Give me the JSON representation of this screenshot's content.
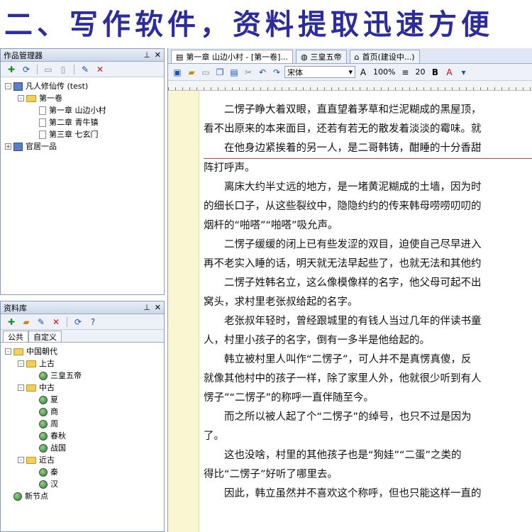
{
  "banner": {
    "text": "二、写作软件，资料提取迅速方便"
  },
  "works_panel": {
    "title": "作品管理器",
    "tree": [
      {
        "label": "凡人修仙传 (test)",
        "level": 0,
        "toggle": "-",
        "icon": "book"
      },
      {
        "label": "第一卷",
        "level": 1,
        "toggle": "-",
        "icon": "folder"
      },
      {
        "label": "第一章 山边小村",
        "level": 2,
        "icon": "doc"
      },
      {
        "label": "第二章 青牛镇",
        "level": 2,
        "icon": "doc"
      },
      {
        "label": "第三章 七玄门",
        "level": 2,
        "icon": "doc"
      },
      {
        "label": "官居一品",
        "level": 0,
        "toggle": "+",
        "icon": "book"
      }
    ]
  },
  "library_panel": {
    "title": "资料库",
    "tabs": [
      "公共",
      "自定义"
    ],
    "tree": [
      {
        "label": "中国朝代",
        "level": 0,
        "toggle": "-",
        "icon": "folder"
      },
      {
        "label": "上古",
        "level": 1,
        "toggle": "-",
        "icon": "folder"
      },
      {
        "label": "三皇五帝",
        "level": 2,
        "icon": "globe"
      },
      {
        "label": "中古",
        "level": 1,
        "toggle": "-",
        "icon": "folder"
      },
      {
        "label": "夏",
        "level": 2,
        "icon": "globe"
      },
      {
        "label": "商",
        "level": 2,
        "icon": "globe"
      },
      {
        "label": "周",
        "level": 2,
        "icon": "globe"
      },
      {
        "label": "春秋",
        "level": 2,
        "icon": "globe"
      },
      {
        "label": "战国",
        "level": 2,
        "icon": "globe"
      },
      {
        "label": "近古",
        "level": 1,
        "toggle": "-",
        "icon": "folder"
      },
      {
        "label": "秦",
        "level": 2,
        "icon": "globe"
      },
      {
        "label": "汉",
        "level": 2,
        "icon": "globe"
      },
      {
        "label": "新节点",
        "level": 0,
        "icon": "globe"
      }
    ]
  },
  "editor": {
    "tabs": [
      {
        "label": "第一章 山边小村 - [第一卷]...",
        "active": true
      },
      {
        "label": "三皇五帝",
        "active": false
      },
      {
        "label": "首页(建设中...)",
        "active": false
      }
    ],
    "font_name": "宋体",
    "zoom": "100%",
    "line_spacing": "20",
    "lines": [
      {
        "text": "二愣子睁大着双眼，直直望着茅草和烂泥糊成的黑屋顶，",
        "indent": true
      },
      {
        "text": "看不出原来的本来面目，还若有若无的散发着淡淡的霉味。就",
        "indent": false
      },
      {
        "text": "在他身边紧挨着的另一人，是二哥韩铸，酣睡的十分香甜",
        "indent": true,
        "underline": true
      },
      {
        "text": "阵打呼声。",
        "indent": false
      },
      {
        "text": "离床大约半丈远的地方，是一堵黄泥糊成的土墙，因为时",
        "indent": true
      },
      {
        "text": "的细长口子，从这些裂纹中，隐隐约约的传来韩母唠唠叨叨的",
        "indent": false
      },
      {
        "text": "烟杆的“啪嗒”“啪嗒”吸允声。",
        "indent": false
      },
      {
        "text": "二愣子缓缓的闭上已有些发涩的双目，迫使自己尽早进入",
        "indent": true
      },
      {
        "text": "再不老实入睡的话，明天就无法早起些了，也就无法和其他约",
        "indent": false
      },
      {
        "text": "二愣子姓韩名立，这么像模像样的名字，他父母可起不出",
        "indent": true
      },
      {
        "text": "窝头，求村里老张叔给起的名字。",
        "indent": false
      },
      {
        "text": "老张叔年轻时，曾经跟城里的有钱人当过几年的伴读书童",
        "indent": true
      },
      {
        "text": "人，村里小孩子的名字，倒有一多半是他给起的。",
        "indent": false
      },
      {
        "text": "韩立被村里人叫作“二愣子”，可人并不是真愣真傻，反",
        "indent": true
      },
      {
        "text": "就像其他村中的孩子一样，除了家里人外，他就很少听到有人",
        "indent": false
      },
      {
        "text": "愣子”“二愣子”的称呼一直伴随至今。",
        "indent": false
      },
      {
        "text": "而之所以被人起了个“二愣子”的绰号，也只不过是因为",
        "indent": true
      },
      {
        "text": "了。",
        "indent": false
      },
      {
        "text": "这也没啥，村里的其他孩子也是“狗娃”“二蛋”之类的",
        "indent": true
      },
      {
        "text": "得比“二愣子”好听了哪里去。",
        "indent": false
      },
      {
        "text": "因此，韩立虽然并不喜欢这个称呼，但也只能这样一直的",
        "indent": true
      }
    ]
  }
}
